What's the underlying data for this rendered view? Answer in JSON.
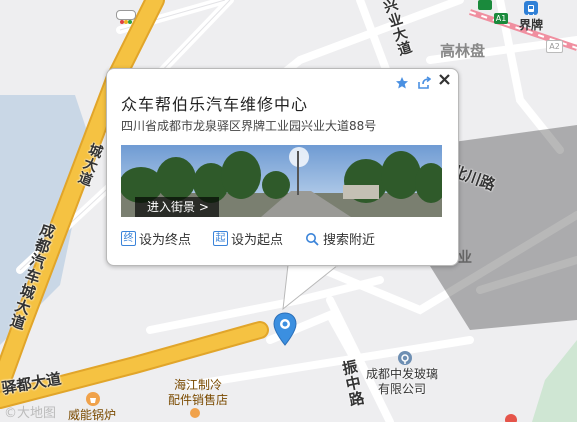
{
  "popup": {
    "title": "众车帮伯乐汽车维修中心",
    "address": "四川省成都市龙泉驿区界牌工业园兴业大道88号",
    "streetview_label": "进入街景 >",
    "actions": [
      {
        "label": "设为终点",
        "icon": "终"
      },
      {
        "label": "设为起点",
        "icon": "起"
      },
      {
        "label": "搜索附近"
      }
    ]
  },
  "map": {
    "roads": {
      "chengdu_qiche_cheng": "成都汽车城大道",
      "cheng_da_dao": "城大道",
      "yidu_dadao": "驿都大道",
      "xingye_dadao": "兴业大道",
      "zhenzhong_lu": "振中路",
      "beichuan_lu": "北川路"
    },
    "areas": {
      "gaolinpan": "高林盘",
      "industry_fragment": "业"
    },
    "pois": {
      "fabo": "成都中发玻璃\n有限公司",
      "haijiang": "海江制冷\n配件销售店",
      "weineng": "威能锅炉",
      "jiepai": "界牌",
      "a1": "A1",
      "a2": "A2"
    },
    "watermark": "©大地图"
  },
  "colors": {
    "main_road": "#f5c242",
    "main_road_edge": "#e1a52a",
    "map_bg": "#eeeef0",
    "water": "#c9d7e6",
    "accent_blue": "#3b84d9",
    "rail_pink": "#f08fa0"
  }
}
